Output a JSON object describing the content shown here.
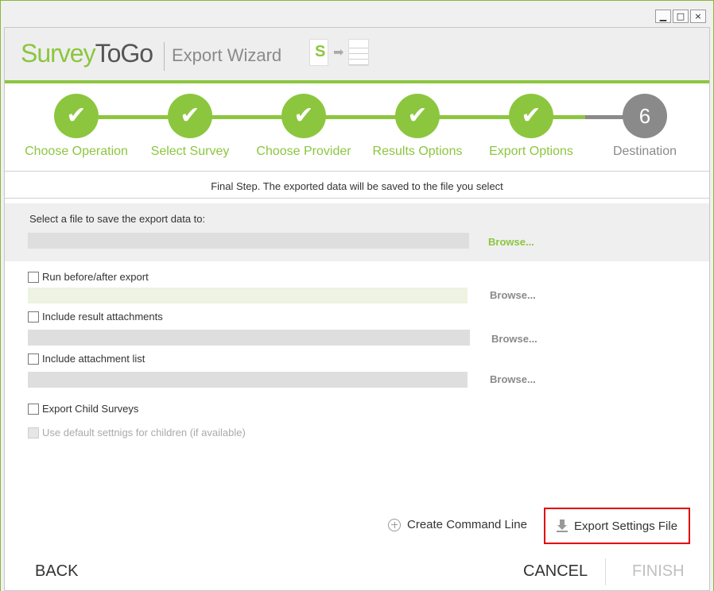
{
  "window": {
    "minimize_label": "▁",
    "maximize_label": "□",
    "close_label": "×"
  },
  "header": {
    "logo_part1": "Survey",
    "logo_part2": "ToGo",
    "wizard_title": "Export Wizard",
    "icon_letter": "S"
  },
  "steps": [
    {
      "label": "Choose Operation",
      "state": "done",
      "mark": "✔"
    },
    {
      "label": "Select Survey",
      "state": "done",
      "mark": "✔"
    },
    {
      "label": "Choose Provider",
      "state": "done",
      "mark": "✔"
    },
    {
      "label": "Results Options",
      "state": "done",
      "mark": "✔"
    },
    {
      "label": "Export Options",
      "state": "done",
      "mark": "✔"
    },
    {
      "label": "Destination",
      "state": "current",
      "mark": "6"
    }
  ],
  "info_text": "Final Step. The exported data will be saved to the file you select",
  "file_section": {
    "label": "Select a file to save the export data to:",
    "value": "",
    "browse_label": "Browse..."
  },
  "options": {
    "run_before_after": {
      "label": "Run before/after export",
      "checked": false,
      "value": "",
      "browse_label": "Browse..."
    },
    "include_result_attachments": {
      "label": "Include result attachments",
      "checked": false,
      "value": "",
      "browse_label": "Browse..."
    },
    "include_attachment_list": {
      "label": "Include attachment list",
      "checked": false,
      "value": "",
      "browse_label": "Browse..."
    },
    "export_child_surveys": {
      "label": "Export Child Surveys",
      "checked": false
    },
    "use_default_settings": {
      "label": "Use default settnigs for children (if available)",
      "checked": false,
      "disabled": true
    }
  },
  "actions": {
    "create_command_line": "Create Command Line",
    "export_settings_file": "Export Settings File"
  },
  "footer": {
    "back": "BACK",
    "cancel": "CANCEL",
    "finish": "FINISH"
  },
  "colors": {
    "accent": "#8cc63f",
    "highlight_border": "#e00000",
    "inactive": "#8a8a8a"
  }
}
